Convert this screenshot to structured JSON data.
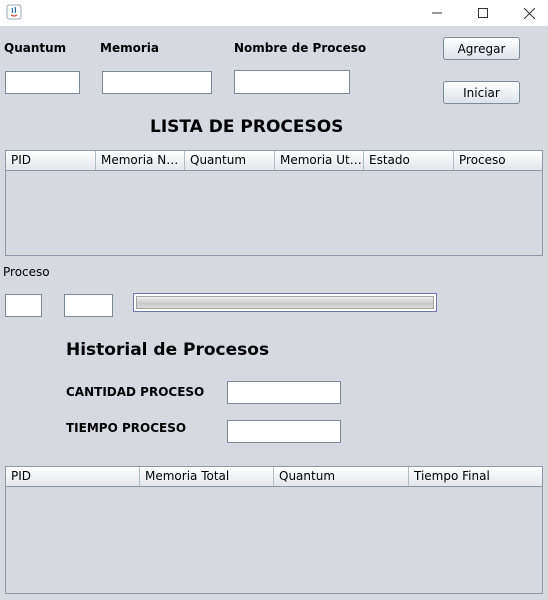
{
  "window": {
    "title": "",
    "icon": "java-icon",
    "controls": {
      "minimize": "minimize-icon",
      "maximize": "maximize-icon",
      "close": "close-icon"
    }
  },
  "form": {
    "quantum_label": "Quantum",
    "memoria_label": "Memoria",
    "nombre_label": "Nombre de Proceso",
    "quantum_value": "",
    "memoria_value": "",
    "nombre_value": ""
  },
  "buttons": {
    "agregar": "Agregar",
    "iniciar": "Iniciar"
  },
  "lista": {
    "title": "LISTA DE PROCESOS",
    "columns": [
      "PID",
      "Memoria Ne...",
      "Quantum",
      "Memoria Util...",
      "Estado",
      "Proceso"
    ],
    "rows": []
  },
  "proceso": {
    "label": "Proceso",
    "field1_value": "",
    "field2_value": "",
    "progress_fraction": 0
  },
  "historial": {
    "title": "Historial de Procesos",
    "cantidad_label": "CANTIDAD PROCESO",
    "tiempo_label": "TIEMPO PROCESO",
    "cantidad_value": "",
    "tiempo_value": "",
    "columns": [
      "PID",
      "Memoria Total",
      "Quantum",
      "Tiempo Final"
    ],
    "rows": []
  },
  "colors": {
    "background": "#d6d9df",
    "progress_border": "#6e78b8"
  }
}
